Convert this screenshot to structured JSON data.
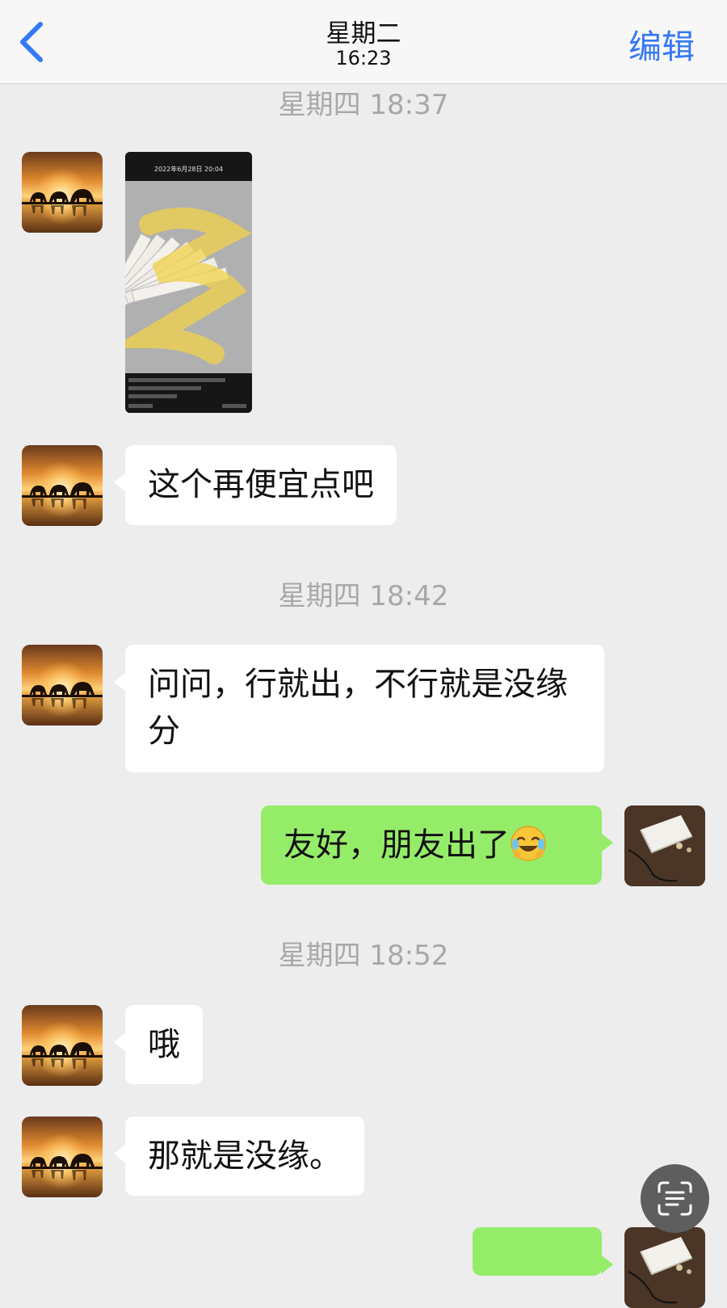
{
  "header": {
    "title": "星期二",
    "subtitle": "16:23",
    "edit_label": "编辑"
  },
  "timestamps": [
    "星期四 18:37",
    "星期四 18:42",
    "星期四 18:52"
  ],
  "image_message": {
    "date_text": "2022年6月28日 20:04"
  },
  "messages": [
    {
      "side": "in",
      "text": "这个再便宜点吧"
    },
    {
      "side": "in",
      "text": "问问，行就出，不行就是没缘分"
    },
    {
      "side": "out",
      "text": "友好，朋友出了",
      "emoji": "face-with-tears-of-joy"
    },
    {
      "side": "in",
      "text": "哦"
    },
    {
      "side": "in",
      "text": "那就是没缘。"
    }
  ],
  "icons": {
    "back": "chevron-left-icon",
    "avatar_contact": "elephant-sunset-avatar",
    "avatar_self": "white-device-avatar",
    "scan": "text-scan-icon"
  },
  "colors": {
    "accent": "#3478f6",
    "outgoing_bubble": "#95ec69",
    "incoming_bubble": "#ffffff",
    "background": "#ededed"
  }
}
